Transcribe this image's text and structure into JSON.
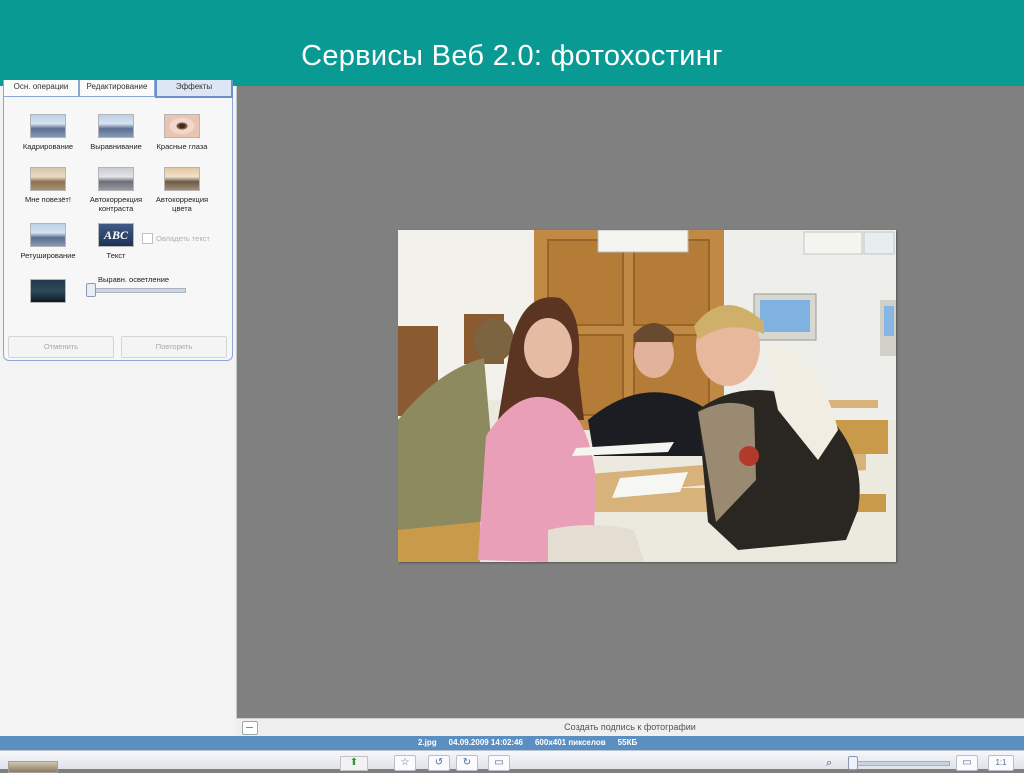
{
  "slide": {
    "title": "Сервисы Веб 2.0: фотохостинг"
  },
  "tabs": [
    {
      "label": "Осн. операции"
    },
    {
      "label": "Редактирование"
    },
    {
      "label": "Эффекты"
    }
  ],
  "tools": [
    {
      "label": "Кадрирование",
      "icon": "crop-icon"
    },
    {
      "label": "Выравнивание",
      "icon": "align-icon"
    },
    {
      "label": "Красные глаза",
      "icon": "red-eye-icon"
    },
    {
      "label": "Мне повезёт!",
      "icon": "lucky-icon"
    },
    {
      "label": "Автокоррекция контраста",
      "icon": "auto-contrast-icon"
    },
    {
      "label": "Автокоррекция цвета",
      "icon": "auto-color-icon"
    },
    {
      "label": "Ретуширование",
      "icon": "retouch-icon"
    },
    {
      "label": "Текст",
      "icon": "text-icon",
      "glyph": "ABC"
    }
  ],
  "text_checkbox_label": "Овладеть текст",
  "fill_light": {
    "label": "Выравн. осветление",
    "value": 0.0
  },
  "buttons": {
    "undo": "Отменить",
    "redo": "Повторить"
  },
  "caption": {
    "placeholder": "Создать подпись к фотографии"
  },
  "info": {
    "filename": "2.jpg",
    "datetime": "04.09.2009 14:02:46",
    "dimensions": "600x401 пикселов",
    "size": "55КБ"
  },
  "colors": {
    "title_bar": "#0a9a94",
    "canvas_bg": "#808080",
    "info_bar": "#5b8fc2"
  }
}
